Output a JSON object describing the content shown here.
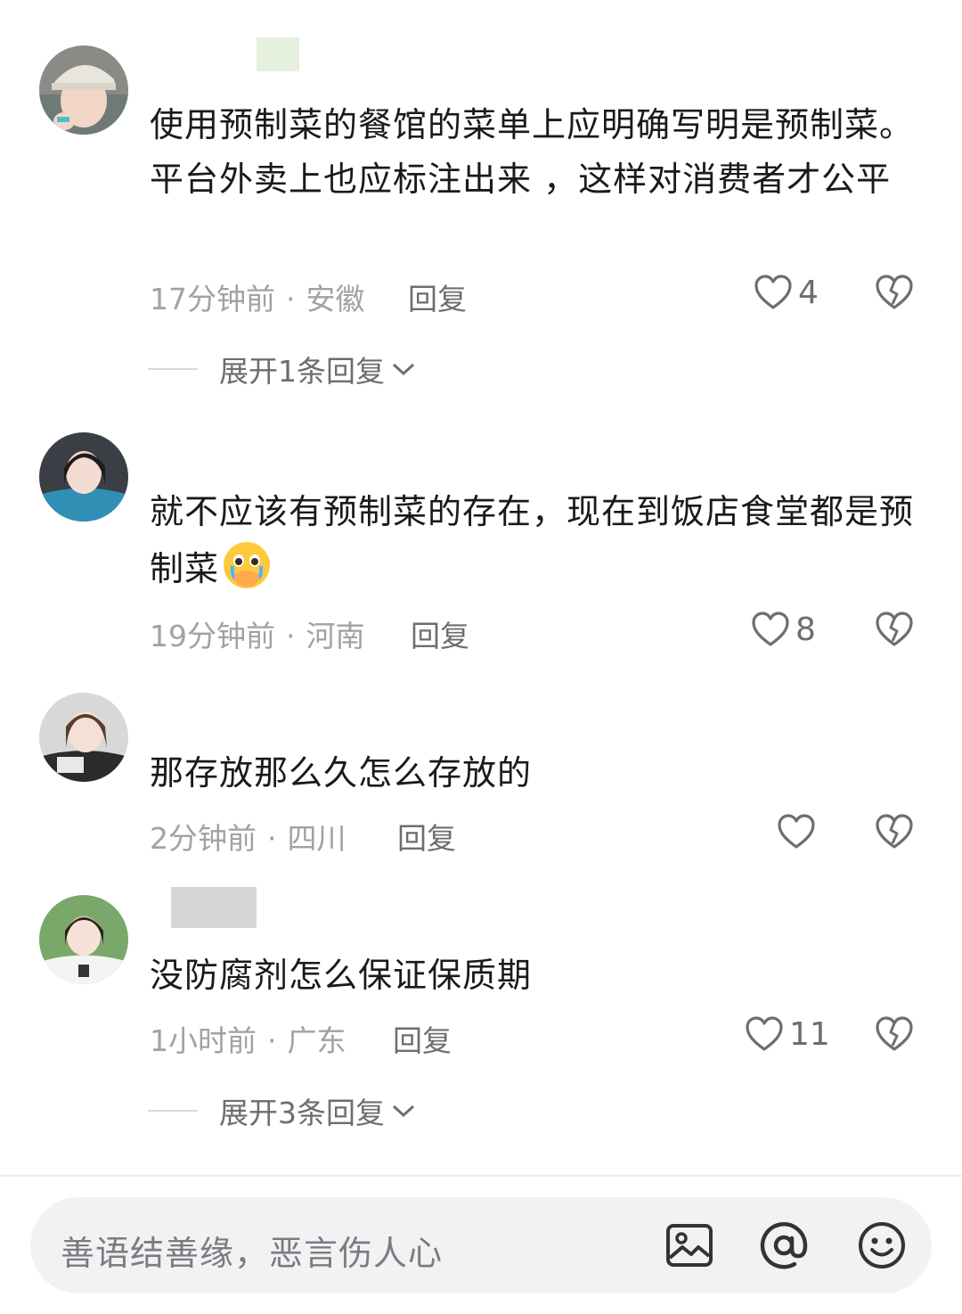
{
  "comments": [
    {
      "text": "使用预制菜的餐馆的菜单上应明确写明是预制菜。平台外卖上也应标注出来 ，这样对消费者才公平",
      "time": "17分钟前",
      "location": "安徽",
      "reply_label": "回复",
      "likes": "4",
      "expand_label": "展开1条回复"
    },
    {
      "text": "就不应该有预制菜的存在，现在到饭店食堂都是预制菜",
      "emoji": "crying-hand-over-mouth-emoji",
      "time": "19分钟前",
      "location": "河南",
      "reply_label": "回复",
      "likes": "8"
    },
    {
      "text": "那存放那么久怎么存放的",
      "time": "2分钟前",
      "location": "四川",
      "reply_label": "回复",
      "likes": ""
    },
    {
      "text": "没防腐剂怎么保证保质期",
      "time": "1小时前",
      "location": "广东",
      "reply_label": "回复",
      "likes": "11",
      "expand_label": "展开3条回复"
    }
  ],
  "composer": {
    "placeholder": "善语结善缘，恶言伤人心",
    "icons": [
      "image-icon",
      "at-icon",
      "emoji-icon"
    ]
  },
  "colors": {
    "text": "#1a1a1a",
    "meta": "#a1a1a6",
    "action": "#6d6d72",
    "composer_bg": "#f2f2f4"
  }
}
